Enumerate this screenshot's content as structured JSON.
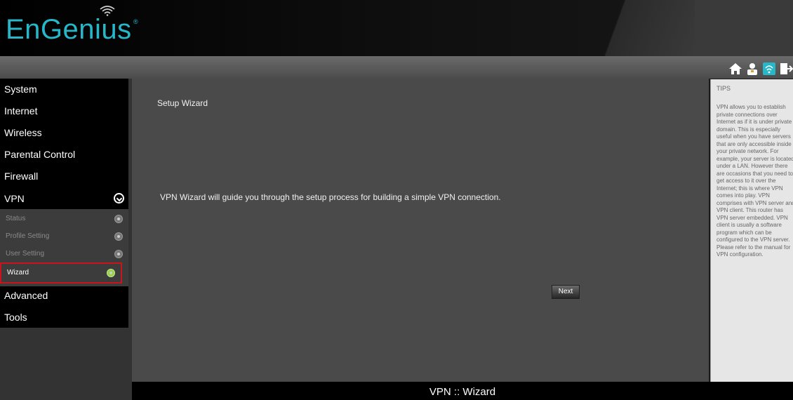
{
  "header": {
    "logo": "EnGenius",
    "logo_mark": "®"
  },
  "toolbar": {
    "icons": [
      "home-icon",
      "user-icon",
      "setup-icon",
      "logout-icon"
    ]
  },
  "sidebar": {
    "items": [
      {
        "label": "System"
      },
      {
        "label": "Internet"
      },
      {
        "label": "Wireless"
      },
      {
        "label": "Parental Control"
      },
      {
        "label": "Firewall"
      },
      {
        "label": "VPN"
      },
      {
        "label": "Advanced"
      },
      {
        "label": "Tools"
      }
    ],
    "vpn_sub": [
      {
        "label": "Status"
      },
      {
        "label": "Profile Setting"
      },
      {
        "label": "User Setting"
      },
      {
        "label": "Wizard"
      }
    ]
  },
  "main": {
    "title": "Setup Wizard",
    "description": "VPN Wizard will guide you through the setup process for building a simple VPN connection.",
    "next_label": "Next"
  },
  "tips": {
    "title": "TIPS",
    "body": "VPN allows you to establish private connections over Internet as if it is under private domain. This is especially useful when you have servers that are only accessible inside your private network. For example, your server is located under a LAN. However there are occasions that you need to get access to it over the Internet; this is where VPN comes into play. VPN comprises with VPN server and VPN client. This router has VPN server embedded. VPN client is usually a software program which can be configured to the VPN server. Please refer to the manual for VPN configuration."
  },
  "footer": {
    "text": "VPN :: Wizard"
  },
  "colors": {
    "brand": "#26b7c9",
    "highlight": "#c8151b",
    "active_dot": "#9ad14b"
  }
}
